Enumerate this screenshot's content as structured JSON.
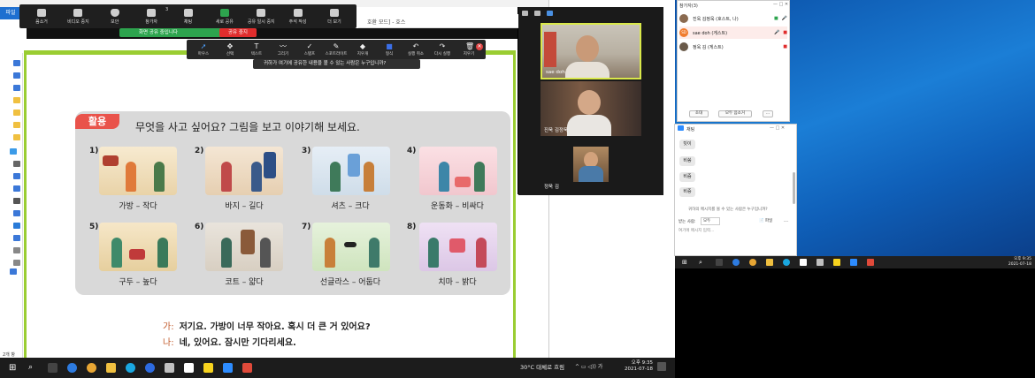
{
  "zoom_toolbar": {
    "items": [
      {
        "label": "음소거",
        "icon": "microphone-icon"
      },
      {
        "label": "비디오 중지",
        "icon": "video-camera-icon"
      },
      {
        "label": "보안",
        "icon": "shield-icon"
      },
      {
        "label": "참가자",
        "icon": "participants-icon",
        "count": "3"
      },
      {
        "label": "채팅",
        "icon": "chat-icon"
      },
      {
        "label": "새로 공유",
        "icon": "share-screen-icon"
      },
      {
        "label": "공유 일시 중지",
        "icon": "pause-icon"
      },
      {
        "label": "주석 작성",
        "icon": "annotate-icon"
      },
      {
        "label": "더 보기",
        "icon": "more-icon"
      }
    ],
    "sharing_status": "화면 공유 중입니다",
    "stop_share": "공유 중지"
  },
  "annotation_toolbar": {
    "items": [
      {
        "label": "마우스",
        "icon": "mouse-icon",
        "glyph": "➚",
        "selected": true
      },
      {
        "label": "선택",
        "icon": "select-icon",
        "glyph": "✥"
      },
      {
        "label": "텍스트",
        "icon": "text-icon",
        "glyph": "T"
      },
      {
        "label": "그리기",
        "icon": "draw-icon",
        "glyph": "〰"
      },
      {
        "label": "스탬프",
        "icon": "stamp-icon",
        "glyph": "✓"
      },
      {
        "label": "스포트라이트",
        "icon": "spotlight-icon",
        "glyph": "✎"
      },
      {
        "label": "지우개",
        "icon": "eraser-icon",
        "glyph": "◆"
      },
      {
        "label": "형식",
        "icon": "format-icon",
        "glyph": "■"
      },
      {
        "label": "실행 취소",
        "icon": "undo-icon",
        "glyph": "↶"
      },
      {
        "label": "다시 실행",
        "icon": "redo-icon",
        "glyph": "↷"
      },
      {
        "label": "지우기",
        "icon": "trash-icon",
        "glyph": "🗑"
      }
    ],
    "info": "귀하가 여기에 공유한 내용을 볼 수 있는 사람은 누구입니까?"
  },
  "document": {
    "window_title": "호환 모드] - 호스",
    "explorer_tab": "파일",
    "explorer_status": "2개 항",
    "card_tag": "활용",
    "card_title": "무엇을 사고 싶어요? 그림을 보고 이야기해 보세요.",
    "items": [
      {
        "num": "1)",
        "caption": "가방 – 작다"
      },
      {
        "num": "2)",
        "caption": "바지 – 길다"
      },
      {
        "num": "3)",
        "caption": "셔츠 – 크다"
      },
      {
        "num": "4)",
        "caption": "운동화 – 비싸다"
      },
      {
        "num": "5)",
        "caption": "구두 – 높다"
      },
      {
        "num": "6)",
        "caption": "코트 – 얇다"
      },
      {
        "num": "7)",
        "caption": "선글라스 – 어둡다"
      },
      {
        "num": "8)",
        "caption": "치마 – 밝다"
      }
    ],
    "dialog": [
      {
        "speaker": "가:",
        "text": "저기요. 가방이 너무 작아요. 혹시 더 큰 거 있어요?"
      },
      {
        "speaker": "나:",
        "text": "네, 있어요. 잠시만 기다리세요."
      }
    ]
  },
  "gallery": {
    "videos": [
      {
        "name": "sae doh"
      },
      {
        "name": "진욱 김정욱"
      },
      {
        "name": "정욱 김"
      }
    ]
  },
  "participants": {
    "title": "참가자(3)",
    "list": [
      {
        "name": "진욱 김정욱 (호스트, 나)",
        "color": "#8a6a50"
      },
      {
        "name": "sae doh (게스트)",
        "color": "#f07c2e",
        "initials": "SD"
      },
      {
        "name": "정욱 김 (게스트)",
        "color": "#6a5a4a"
      }
    ],
    "invite": "초대",
    "mute_all": "모두 음소거",
    "more": "..."
  },
  "chat": {
    "title": "채팅",
    "messages": [
      "빗이",
      "비쓩",
      "비즘",
      "비증"
    ],
    "notice": "귀하의 메시지를 볼 수 있는 사람은 누구입니까?",
    "to_label": "받는 사람:",
    "to_value": "모두",
    "file_label": "파일",
    "input_placeholder": "여기에 메시지 입력..."
  },
  "taskbar_left": {
    "tray": "30°C  대체로 흐림",
    "time": "오후 9:35",
    "date": "2021-07-18"
  },
  "taskbar_right": {
    "time": "오후 9:35",
    "date": "2021-07-18"
  }
}
